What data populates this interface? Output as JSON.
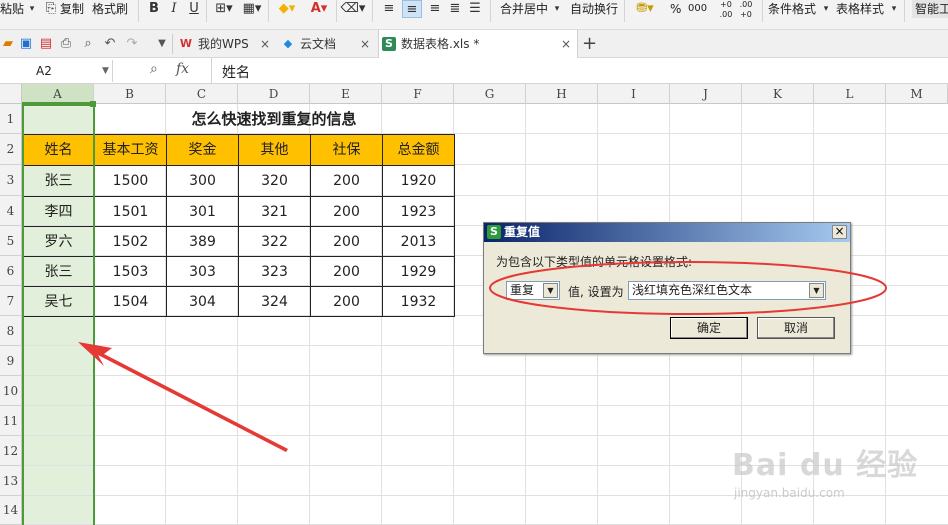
{
  "toolbar": {
    "paste": "粘贴",
    "copy": "复制",
    "format_painter": "格式刷",
    "bold": "B",
    "italic": "I",
    "underline": "U",
    "merge_center": "合并居中",
    "wrap_text": "自动换行",
    "percent": "%",
    "thousands": "000",
    "inc_decimal": "+0 .00",
    "dec_decimal": ".00 +0",
    "conditional_format": "条件格式",
    "table_style": "表格样式",
    "smart_tools": "智能工"
  },
  "tabs": [
    {
      "label": "我的WPS",
      "icon": "W",
      "close": "×"
    },
    {
      "label": "云文档",
      "icon": "◆",
      "close": "×"
    },
    {
      "label": "数据表格.xls *",
      "icon": "S",
      "close": "×"
    }
  ],
  "new_tab": "+",
  "formula_bar": {
    "cell_ref": "A2",
    "fx": "fx",
    "value": "姓名"
  },
  "sheet": {
    "columns": [
      "A",
      "B",
      "C",
      "D",
      "E",
      "F",
      "G",
      "H",
      "I",
      "J",
      "K",
      "L",
      "M"
    ],
    "rows": [
      "1",
      "2",
      "3",
      "4",
      "5",
      "6",
      "7",
      "8",
      "9",
      "10",
      "11",
      "12",
      "13",
      "14"
    ],
    "title": "怎么快速找到重复的信息",
    "headers": [
      "姓名",
      "基本工资",
      "奖金",
      "其他",
      "社保",
      "总金额"
    ],
    "data": [
      [
        "张三",
        "1500",
        "300",
        "320",
        "200",
        "1920"
      ],
      [
        "李四",
        "1501",
        "301",
        "321",
        "200",
        "1923"
      ],
      [
        "罗六",
        "1502",
        "389",
        "322",
        "200",
        "2013"
      ],
      [
        "张三",
        "1503",
        "303",
        "323",
        "200",
        "1929"
      ],
      [
        "吴七",
        "1504",
        "304",
        "324",
        "200",
        "1932"
      ]
    ]
  },
  "dialog": {
    "title": "重复值",
    "instruction": "为包含以下类型值的单元格设置格式:",
    "type_value": "重复",
    "set_as_label": "值, 设置为",
    "format_value": "浅红填充色深红色文本",
    "ok": "确定",
    "cancel": "取消",
    "close": "×"
  },
  "watermark": {
    "brand": "Bai du 经验",
    "url": "jingyan.baidu.com"
  },
  "colors": {
    "header_fill": "#ffc000",
    "column_highlight": "#e2efda",
    "selection_border": "#4e9a3a",
    "annotation_red": "#e53935"
  }
}
